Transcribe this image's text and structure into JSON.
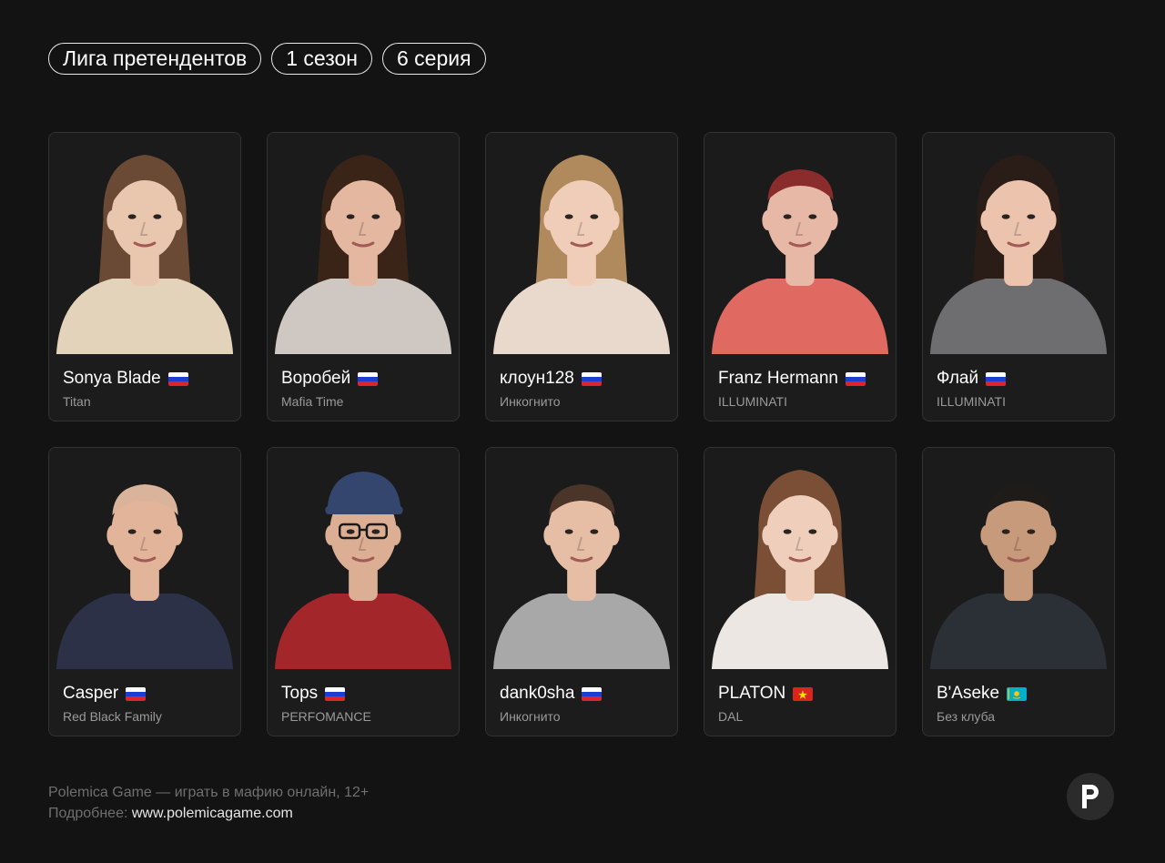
{
  "header": {
    "tags": [
      "Лига претендентов",
      "1 сезон",
      "6 серия"
    ]
  },
  "players": [
    {
      "name": "Sonya Blade",
      "club": "Titan",
      "flag": "ru",
      "photo": {
        "hair": "#6b4a35",
        "skin": "#e9c6ae",
        "shirt": "#e3d3bb",
        "long_hair": true,
        "cap": false,
        "glasses": false
      }
    },
    {
      "name": "Воробей",
      "club": "Mafia Time",
      "flag": "ru",
      "photo": {
        "hair": "#3a2418",
        "skin": "#e4b8a0",
        "shirt": "#cfc7c2",
        "long_hair": true,
        "cap": false,
        "glasses": false
      }
    },
    {
      "name": "клоун128",
      "club": "Инкогнито",
      "flag": "ru",
      "photo": {
        "hair": "#b08a5c",
        "skin": "#efcdb9",
        "shirt": "#e8d9cc",
        "long_hair": true,
        "cap": false,
        "glasses": false
      }
    },
    {
      "name": "Franz Hermann",
      "club": "ILLUMINATI",
      "flag": "ru",
      "photo": {
        "hair": "#8a2c2c",
        "skin": "#e7b8a6",
        "shirt": "#e06a62",
        "long_hair": false,
        "cap": false,
        "glasses": false
      }
    },
    {
      "name": "Флай",
      "club": "ILLUMINATI",
      "flag": "ru",
      "photo": {
        "hair": "#2a1c16",
        "skin": "#ecc4ae",
        "shirt": "#6e6e70",
        "long_hair": true,
        "cap": false,
        "glasses": false
      }
    },
    {
      "name": "Casper",
      "club": "Red Black Family",
      "flag": "ru",
      "photo": {
        "hair": "#d9b39a",
        "skin": "#e2b59b",
        "shirt": "#2c3148",
        "long_hair": false,
        "cap": false,
        "glasses": false
      }
    },
    {
      "name": "Tops",
      "club": "PERFOMANCE",
      "flag": "ru",
      "photo": {
        "hair": "#34466e",
        "skin": "#dcae94",
        "shirt": "#a3262b",
        "long_hair": false,
        "cap": true,
        "glasses": true
      }
    },
    {
      "name": "dank0sha",
      "club": "Инкогнито",
      "flag": "ru",
      "photo": {
        "hair": "#4b3528",
        "skin": "#e6bda5",
        "shirt": "#a8a8a8",
        "long_hair": false,
        "cap": false,
        "glasses": false
      }
    },
    {
      "name": "PLATON",
      "club": "DAL",
      "flag": "vn",
      "photo": {
        "hair": "#7a4f36",
        "skin": "#efcfbc",
        "shirt": "#ece7e2",
        "long_hair": true,
        "cap": false,
        "glasses": false
      }
    },
    {
      "name": "B'Aseke",
      "club": "Без клуба",
      "flag": "kz",
      "photo": {
        "hair": "#1f1b19",
        "skin": "#c79a7c",
        "shirt": "#2b2f36",
        "long_hair": false,
        "cap": false,
        "glasses": false
      }
    }
  ],
  "footer": {
    "line1": "Polemica Game — играть в мафию онлайн, 12+",
    "more_label": "Подробнее:",
    "link": "www.polemicagame.com"
  },
  "logo": {
    "letter": "P",
    "icon": "polemica-logo"
  }
}
